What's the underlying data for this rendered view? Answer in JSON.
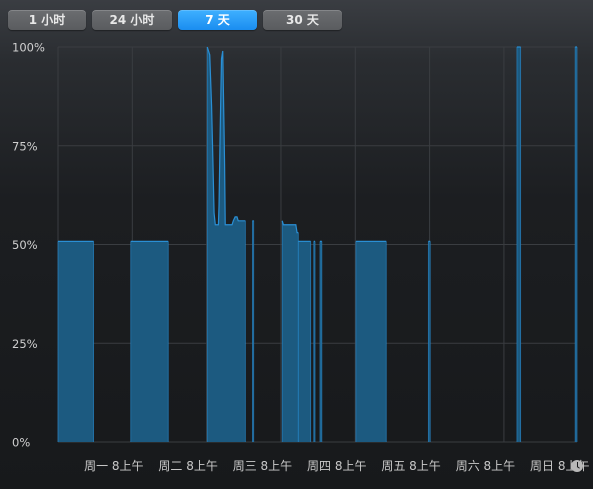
{
  "range_selector": {
    "options": [
      "1 小时",
      "24 小时",
      "7 天",
      "30 天"
    ],
    "selected": "7 天"
  },
  "colors": {
    "fill": "#1c5a80",
    "stroke": "#2a8fd4",
    "grid": "#3a3d41",
    "active_tab": "#1a8df0"
  },
  "icons": {
    "time_icon": "clock-icon"
  },
  "chart_data": {
    "type": "area",
    "ylim": [
      0,
      100
    ],
    "y_ticks": [
      "100%",
      "75%",
      "50%",
      "25%",
      "0%"
    ],
    "x_unit": "hours_since_mon_00",
    "xlim": [
      0,
      166
    ],
    "x_tick_labels": [
      "周一 8上午",
      "周二 8上午",
      "周三 8上午",
      "周四 8上午",
      "周五 8上午",
      "周六 8上午",
      "周日 8上午"
    ],
    "x_tick_values": [
      8,
      32,
      56,
      80,
      104,
      128,
      152
    ],
    "grid": true,
    "segments": [
      {
        "points": [
          [
            0,
            50.8
          ],
          [
            11.5,
            50.8
          ]
        ]
      },
      {
        "points": [
          [
            23.5,
            50.8
          ],
          [
            35.6,
            50.8
          ]
        ]
      },
      {
        "points": [
          [
            48.2,
            100
          ],
          [
            49.0,
            98
          ],
          [
            49.6,
            85
          ],
          [
            50.0,
            72
          ],
          [
            50.4,
            58
          ],
          [
            50.8,
            55
          ],
          [
            51.8,
            55
          ],
          [
            52.0,
            60
          ],
          [
            52.4,
            80
          ],
          [
            52.8,
            97
          ],
          [
            53.2,
            99
          ],
          [
            53.6,
            80
          ],
          [
            53.8,
            70
          ],
          [
            54.0,
            55
          ],
          [
            56.2,
            55
          ],
          [
            56.6,
            56
          ],
          [
            57.2,
            57
          ],
          [
            57.8,
            57
          ],
          [
            58.2,
            56
          ],
          [
            60.5,
            56
          ]
        ]
      },
      {
        "points": [
          [
            62.8,
            56
          ],
          [
            63.2,
            56
          ]
        ]
      },
      {
        "points": [
          [
            72.4,
            56
          ],
          [
            72.8,
            55
          ],
          [
            76.8,
            55
          ],
          [
            77.2,
            53
          ],
          [
            77.6,
            53
          ]
        ]
      },
      {
        "points": [
          [
            77.6,
            50.8
          ],
          [
            81.6,
            50.8
          ]
        ]
      },
      {
        "points": [
          [
            82.6,
            50.8
          ],
          [
            83.0,
            50.8
          ]
        ]
      },
      {
        "points": [
          [
            84.6,
            50.8
          ],
          [
            85.2,
            50.8
          ]
        ]
      },
      {
        "points": [
          [
            96.2,
            50.8
          ],
          [
            106.0,
            50.8
          ]
        ]
      },
      {
        "points": [
          [
            119.6,
            50.8
          ],
          [
            120.2,
            50.8
          ]
        ]
      },
      {
        "points": [
          [
            148.2,
            100
          ],
          [
            149.4,
            100
          ]
        ]
      },
      {
        "points": [
          [
            167.0,
            100
          ],
          [
            167.6,
            100
          ]
        ]
      }
    ]
  }
}
